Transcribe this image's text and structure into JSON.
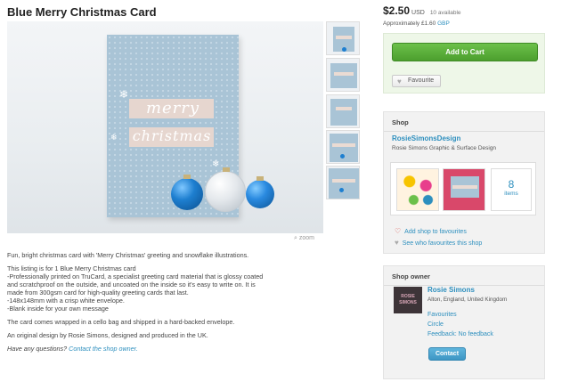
{
  "listing": {
    "title": "Blue Merry Christmas Card",
    "image_word_1": "merry",
    "image_word_2": "christmas",
    "zoom_label": "zoom"
  },
  "description": {
    "p1": "Fun, bright christmas card with 'Merry Christmas' greeting and snowflake illustrations.",
    "p2_lines": [
      "This listing is for 1 Blue Merry Christmas card",
      "-Professionally printed on TruCard, a specialist greeting card material that is glossy coated",
      "and scratchproof on the outside, and uncoated on the inside so it's easy to write on. It is",
      "made from 300gsm card for high-quality greeting cards that last.",
      "-148x148mm with a crisp white envelope.",
      "-Blank inside for your own message"
    ],
    "p3": "The card comes wrapped in a cello bag and shipped in a hard-backed envelope.",
    "p4": "An original design by Rosie Simons, designed and produced in the UK.",
    "question": "Have any questions?",
    "contact_link": "Contact the shop owner."
  },
  "purchase": {
    "price": "$2.50",
    "currency": "USD",
    "availability": "10 available",
    "approx_prefix": "Approximately £1.60",
    "approx_currency": "GBP",
    "add_to_cart": "Add to Cart",
    "favourite": "Favourite"
  },
  "shop": {
    "heading": "Shop",
    "name": "RosieSimonsDesign",
    "subtitle": "Rosie Simons Graphic & Surface Design",
    "item_count": "8",
    "items_label": "items",
    "add_favourites": "Add shop to favourites",
    "see_favourites": "See who favourites this shop"
  },
  "owner": {
    "heading": "Shop owner",
    "avatar_line1": "ROSIE",
    "avatar_line2": "SIMONS",
    "name": "Rosie Simons",
    "location": "Alton, England, United Kingdom",
    "links": [
      "Favourites",
      "Circle",
      "Feedback: No feedback"
    ],
    "contact": "Contact"
  },
  "colors": {
    "accent_link": "#2d8fbe",
    "cart_green": "#5cad3b",
    "card_blue": "#a9c4d6"
  }
}
